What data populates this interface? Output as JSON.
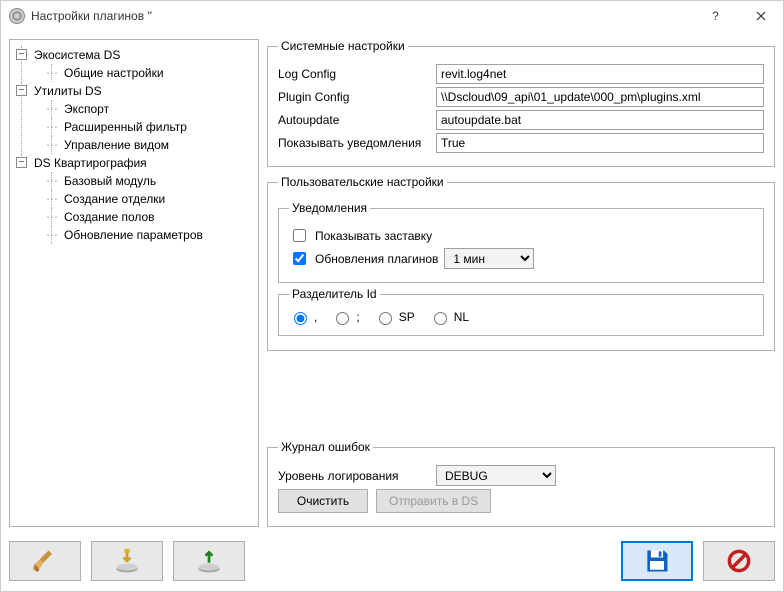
{
  "window": {
    "title": "Настройки плагинов ''"
  },
  "tree": {
    "nodes": [
      {
        "label": "Экосистема DS",
        "children": [
          {
            "label": "Общие настройки"
          }
        ]
      },
      {
        "label": "Утилиты DS",
        "children": [
          {
            "label": "Экспорт"
          },
          {
            "label": "Расширенный фильтр"
          },
          {
            "label": "Управление видом"
          }
        ]
      },
      {
        "label": "DS Квартирография",
        "children": [
          {
            "label": "Базовый модуль"
          },
          {
            "label": "Создание отделки"
          },
          {
            "label": "Создание полов"
          },
          {
            "label": "Обновление параметров"
          }
        ]
      }
    ]
  },
  "system": {
    "legend": "Системные настройки",
    "logconfig_label": "Log Config",
    "logconfig_value": "revit.log4net",
    "pluginconfig_label": "Plugin Config",
    "pluginconfig_value": "\\\\Dscloud\\09_api\\01_update\\000_pm\\plugins.xml",
    "autoupdate_label": "Autoupdate",
    "autoupdate_value": "autoupdate.bat",
    "shownotif_label": "Показывать уведомления",
    "shownotif_value": "True"
  },
  "user": {
    "legend": "Пользовательские настройки",
    "notif": {
      "legend": "Уведомления",
      "splash_label": "Показывать заставку",
      "splash_checked": false,
      "plugupd_label": "Обновления плагинов",
      "plugupd_checked": true,
      "interval_value": "1 мин"
    },
    "separator": {
      "legend": "Разделитель Id",
      "options": [
        ",",
        ";",
        "SP",
        "NL"
      ],
      "selected": ","
    }
  },
  "errorlog": {
    "legend": "Журнал ошибок",
    "level_label": "Уровень логирования",
    "level_value": "DEBUG",
    "clear_label": "Очистить",
    "send_label": "Отправить в DS"
  }
}
